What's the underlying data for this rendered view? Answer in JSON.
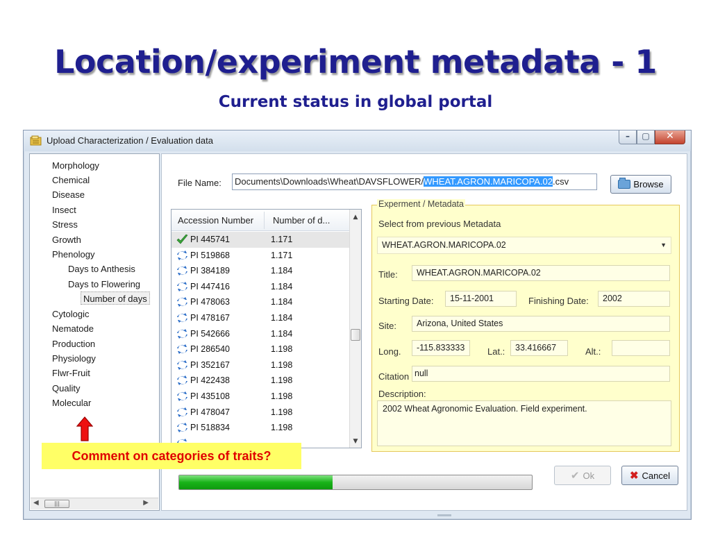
{
  "slide": {
    "title": "Location/experiment metadata - 1",
    "subtitle": "Current status in global portal"
  },
  "window": {
    "title": "Upload Characterization / Evaluation data",
    "controls": {
      "minimize": "–",
      "maximize": "▢",
      "close": "✕"
    }
  },
  "tree": {
    "items": [
      "Morphology",
      "Chemical",
      "Disease",
      "Insect",
      "Stress",
      "Growth",
      "Phenology",
      "Days to Anthesis",
      "Days to Flowering",
      "Number of days",
      "Cytologic",
      "Nematode",
      "Production",
      "Physiology",
      "Flwr-Fruit",
      "Quality",
      "Molecular"
    ],
    "scroll_thumb": "|||"
  },
  "file": {
    "label": "File Name:",
    "value_prefix": "Documents\\Downloads\\Wheat\\DAVSFLOWER/",
    "value_selected": "WHEAT.AGRON.MARICOPA.02",
    "value_suffix": ".csv",
    "browse_label": "Browse"
  },
  "table": {
    "columns": [
      "Accession Number",
      "Number of d..."
    ],
    "rows": [
      {
        "acc": "PI 445741",
        "num": "1.171",
        "icon": "check-icon"
      },
      {
        "acc": "PI 519868",
        "num": "1.171",
        "icon": "refresh-icon"
      },
      {
        "acc": "PI 384189",
        "num": "1.184",
        "icon": "refresh-icon"
      },
      {
        "acc": "PI 447416",
        "num": "1.184",
        "icon": "refresh-icon"
      },
      {
        "acc": "PI 478063",
        "num": "1.184",
        "icon": "refresh-icon"
      },
      {
        "acc": "PI 478167",
        "num": "1.184",
        "icon": "refresh-icon"
      },
      {
        "acc": "PI 542666",
        "num": "1.184",
        "icon": "refresh-icon"
      },
      {
        "acc": "PI 286540",
        "num": "1.198",
        "icon": "refresh-icon"
      },
      {
        "acc": "PI 352167",
        "num": "1.198",
        "icon": "refresh-icon"
      },
      {
        "acc": "PI 422438",
        "num": "1.198",
        "icon": "refresh-icon"
      },
      {
        "acc": "PI 435108",
        "num": "1.198",
        "icon": "refresh-icon"
      },
      {
        "acc": "PI 478047",
        "num": "1.198",
        "icon": "refresh-icon"
      },
      {
        "acc": "PI 518834",
        "num": "1.198",
        "icon": "refresh-icon"
      }
    ]
  },
  "metadata": {
    "group_label": "Experment / Metadata",
    "select_label": "Select from previous Metadata",
    "select_value": "WHEAT.AGRON.MARICOPA.02",
    "title_label": "Title:",
    "title_value": "WHEAT.AGRON.MARICOPA.02",
    "start_label": "Starting Date:",
    "start_value": "15-11-2001",
    "finish_label": "Finishing Date:",
    "finish_value": "2002",
    "site_label": "Site:",
    "site_value": "Arizona, United States",
    "long_label": "Long.",
    "long_value": "-115.833333",
    "lat_label": "Lat.:",
    "lat_value": "33.416667",
    "alt_label": "Alt.:",
    "alt_value": "",
    "citation_label": "Citation",
    "citation_value": "null",
    "description_label": "Description:",
    "description_value": "2002 Wheat Agronomic Evaluation. Field experiment."
  },
  "progress": {
    "value": 0.435
  },
  "buttons": {
    "ok": "Ok",
    "cancel": "Cancel"
  },
  "callout": "Comment on categories of traits?",
  "colors": {
    "title": "#1f1f8f",
    "callout_bg": "#ffff66",
    "callout_text": "#e00000",
    "progress": "#19b319",
    "selection": "#3399ff",
    "metadata_bg": "#ffffcc"
  }
}
